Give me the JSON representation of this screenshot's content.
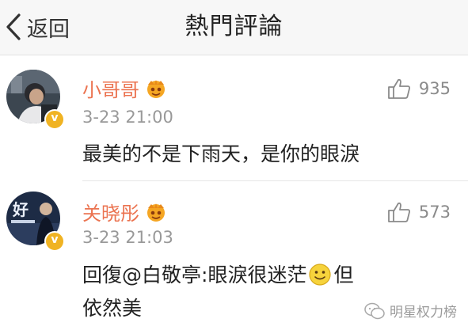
{
  "header": {
    "back_label": "返回",
    "title": "熱門評論"
  },
  "comments": [
    {
      "username": "小哥哥",
      "timestamp": "3-23 21:00",
      "likes": "935",
      "content": "最美的不是下雨天，是你的眼淚",
      "avatar_icon": "avatar-photo-icon"
    },
    {
      "username": "关晓彤",
      "timestamp": "3-23 21:03",
      "likes": "573",
      "content_prefix": "回復",
      "mention": "@白敬亭",
      "content_mid": ":眼淚很迷茫",
      "content_suffix": "但依然美",
      "avatar_icon": "avatar-photo-icon"
    }
  ],
  "watermark": {
    "text": "明星权力榜",
    "icon": "wechat-icon"
  },
  "colors": {
    "username": "#eb7350",
    "verified": "#f0b323",
    "header_bg": "#f7f7f7"
  }
}
